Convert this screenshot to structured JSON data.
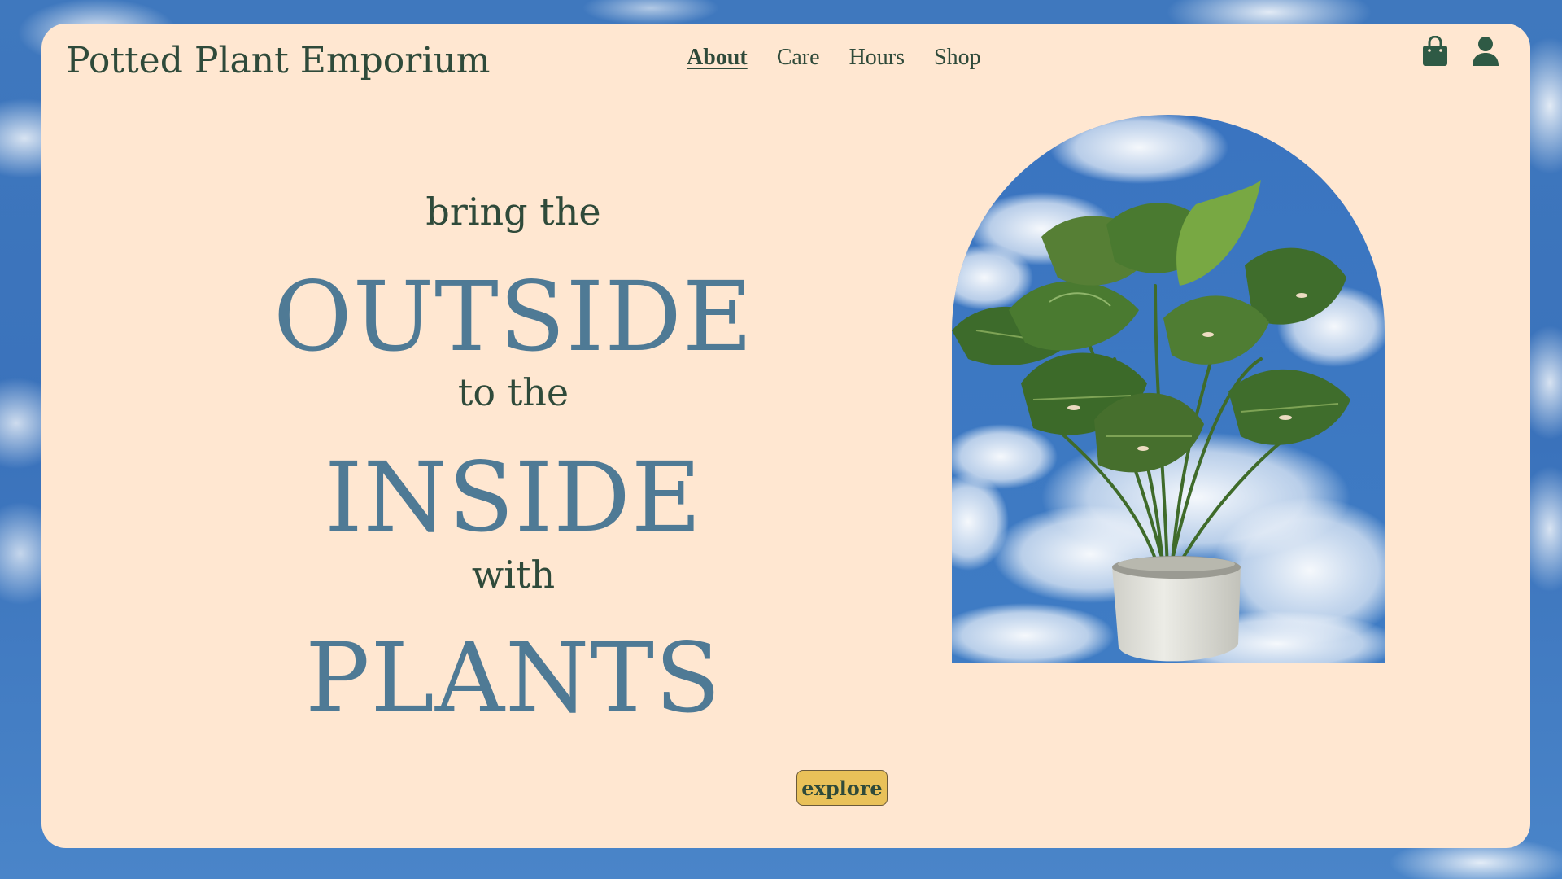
{
  "brand": {
    "title": "Potted Plant Emporium"
  },
  "nav": {
    "items": [
      {
        "label": "About",
        "active": true
      },
      {
        "label": "Care",
        "active": false
      },
      {
        "label": "Hours",
        "active": false
      },
      {
        "label": "Shop",
        "active": false
      }
    ]
  },
  "header_icons": {
    "cart_icon": "shopping-bag-icon",
    "account_icon": "user-icon"
  },
  "hero": {
    "line1": "bring the",
    "line2": "OUTSIDE",
    "line3": "to the",
    "line4": "INSIDE",
    "line5": "with",
    "line6": "PLANTS"
  },
  "cta": {
    "label": "explore"
  },
  "colors": {
    "card_bg": "#ffe7d1",
    "text_dark_green": "#2f4a3a",
    "headline_blue": "#4f7a95",
    "button_yellow": "#e9c159",
    "sky_blue": "#3f78be"
  }
}
